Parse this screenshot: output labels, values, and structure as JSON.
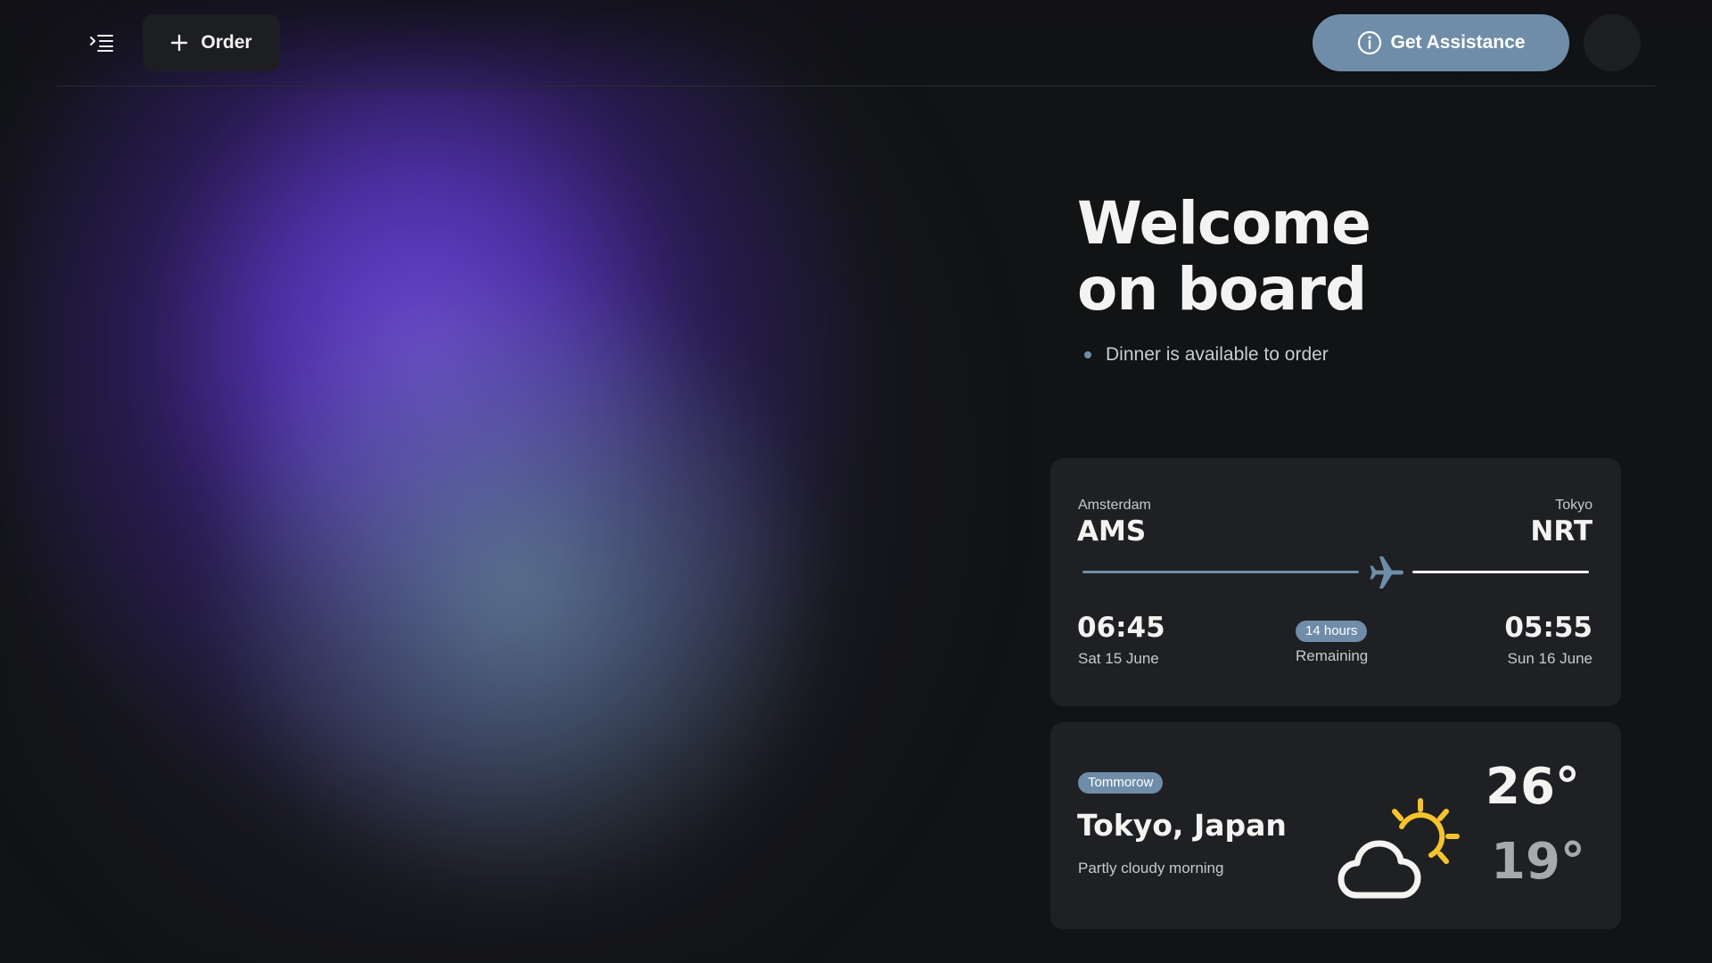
{
  "header": {
    "menu_icon": "menu-icon",
    "order_button": {
      "icon": "plus-icon",
      "label": "Order"
    },
    "assist_button": {
      "icon": "info-icon",
      "label": "Get Assistance"
    },
    "avatar": "avatar"
  },
  "hero": {
    "title_line1": "Welcome",
    "title_line2": "on board",
    "notice": "Dinner is available to order"
  },
  "flight": {
    "origin": {
      "city": "Amsterdam",
      "code": "AMS",
      "time": "06:45",
      "date": "Sat 15 June"
    },
    "destination": {
      "city": "Tokyo",
      "code": "NRT",
      "time": "05:55",
      "date": "Sun 16 June"
    },
    "duration_badge": "14 hours",
    "duration_label": "Remaining",
    "progress_fraction": 0.55,
    "plane_icon": "airplane-icon"
  },
  "weather": {
    "badge": "Tommorow",
    "location": "Tokyo, Japan",
    "condition": "Partly cloudy morning",
    "icon": "partly-cloudy-icon",
    "temp_high": "26°",
    "temp_low": "19°"
  },
  "colors": {
    "accent": "#6f8da8",
    "background": "#111314",
    "card": "#1e2023",
    "sun": "#f5c32c"
  }
}
